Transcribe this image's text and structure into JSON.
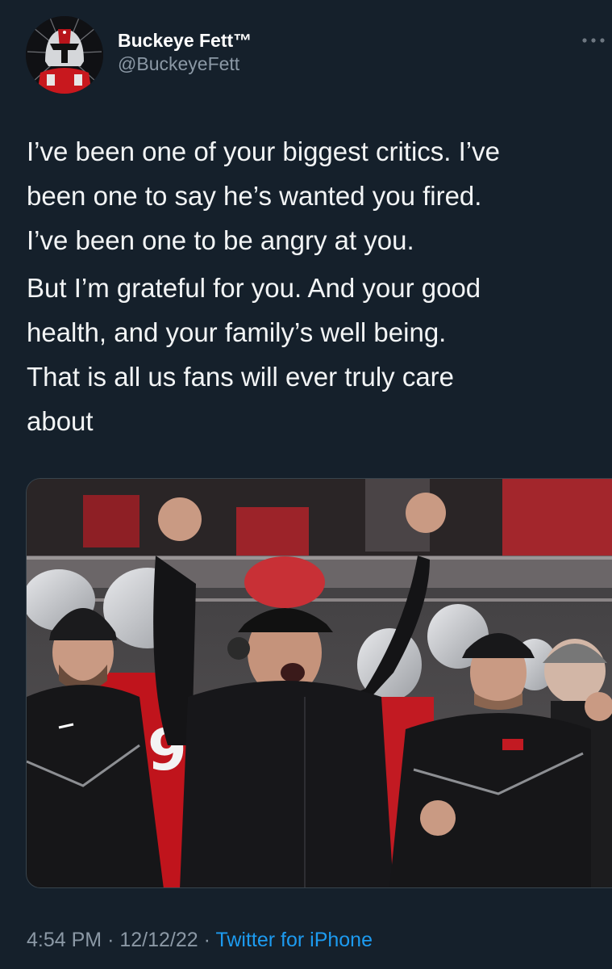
{
  "author": {
    "display_name": "Buckeye Fett™",
    "handle": "@BuckeyeFett",
    "avatar_icon": "helmet-avatar-icon"
  },
  "tweet": {
    "paragraphs": [
      "I’ve been one of your biggest critics. I’ve\nbeen one to say he’s wanted you fired.\nI’ve been one to be angry at you.",
      "But I’m grateful for you. And your good\nhealth, and your family’s well being.\nThat is all us fans will ever truly care\nabout"
    ]
  },
  "meta": {
    "time": "4:54 PM",
    "separator": "·",
    "date": "12/12/22",
    "source": "Twitter for iPhone"
  },
  "colors": {
    "background": "#15202b",
    "secondary_text": "#8b98a5",
    "link": "#1d9bf0",
    "scarlet": "#bb0000"
  }
}
